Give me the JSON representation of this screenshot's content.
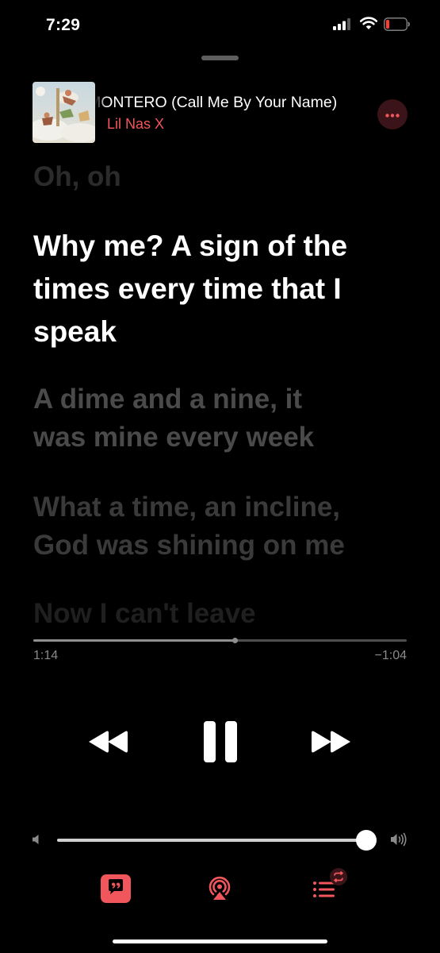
{
  "status_bar": {
    "time": "7:29"
  },
  "now_playing": {
    "title": "MONTERO (Call Me By Your Name)",
    "artist": "Lil Nas X"
  },
  "lyrics": [
    "Oh, oh",
    "Why me? A sign of the\ntimes every time that I\nspeak",
    "A dime and a nine, it\nwas mine every week",
    "What a time, an incline,\nGod was shining on me",
    "Now I can't leave"
  ],
  "active_lyric_index": 1,
  "playback": {
    "elapsed": "1:14",
    "remaining": "−1:04",
    "progress": 0.54,
    "state": "playing"
  },
  "volume": {
    "level": 1.0
  },
  "bottom_bar": {
    "lyrics_icon": "lyrics-quote-icon",
    "airplay_icon": "airplay-audio-icon",
    "queue_icon": "queue-list-icon",
    "lyrics_active": true
  },
  "colors": {
    "accent": "#f0565b",
    "background": "#000000",
    "active_lyric": "#ffffff",
    "inactive_lyric": "#4a4a4a"
  }
}
